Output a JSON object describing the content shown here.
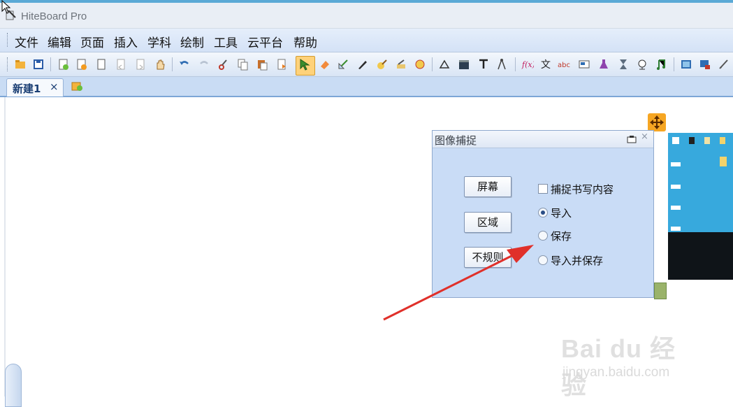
{
  "window": {
    "title": "HiteBoard Pro"
  },
  "menu": [
    "文件",
    "编辑",
    "页面",
    "插入",
    "学科",
    "绘制",
    "工具",
    "云平台",
    "帮助"
  ],
  "tabs": [
    {
      "label": "新建1",
      "close": "×"
    }
  ],
  "dialog": {
    "title": "图像捕捉",
    "buttons": {
      "screen": "屏幕",
      "region": "区域",
      "irregular": "不规则"
    },
    "checkbox_capture_writing": "捕捉书写内容",
    "radio_import": "导入",
    "radio_save": "保存",
    "radio_import_and_save": "导入并保存",
    "selected_radio": "导入"
  },
  "watermark": {
    "logo": "Bai du 经验",
    "url": "jingyan.baidu.com"
  },
  "colors": {
    "accent": "#5aa9d6",
    "selected_tool": "#ffd27a",
    "arrow": "#e0302a"
  }
}
